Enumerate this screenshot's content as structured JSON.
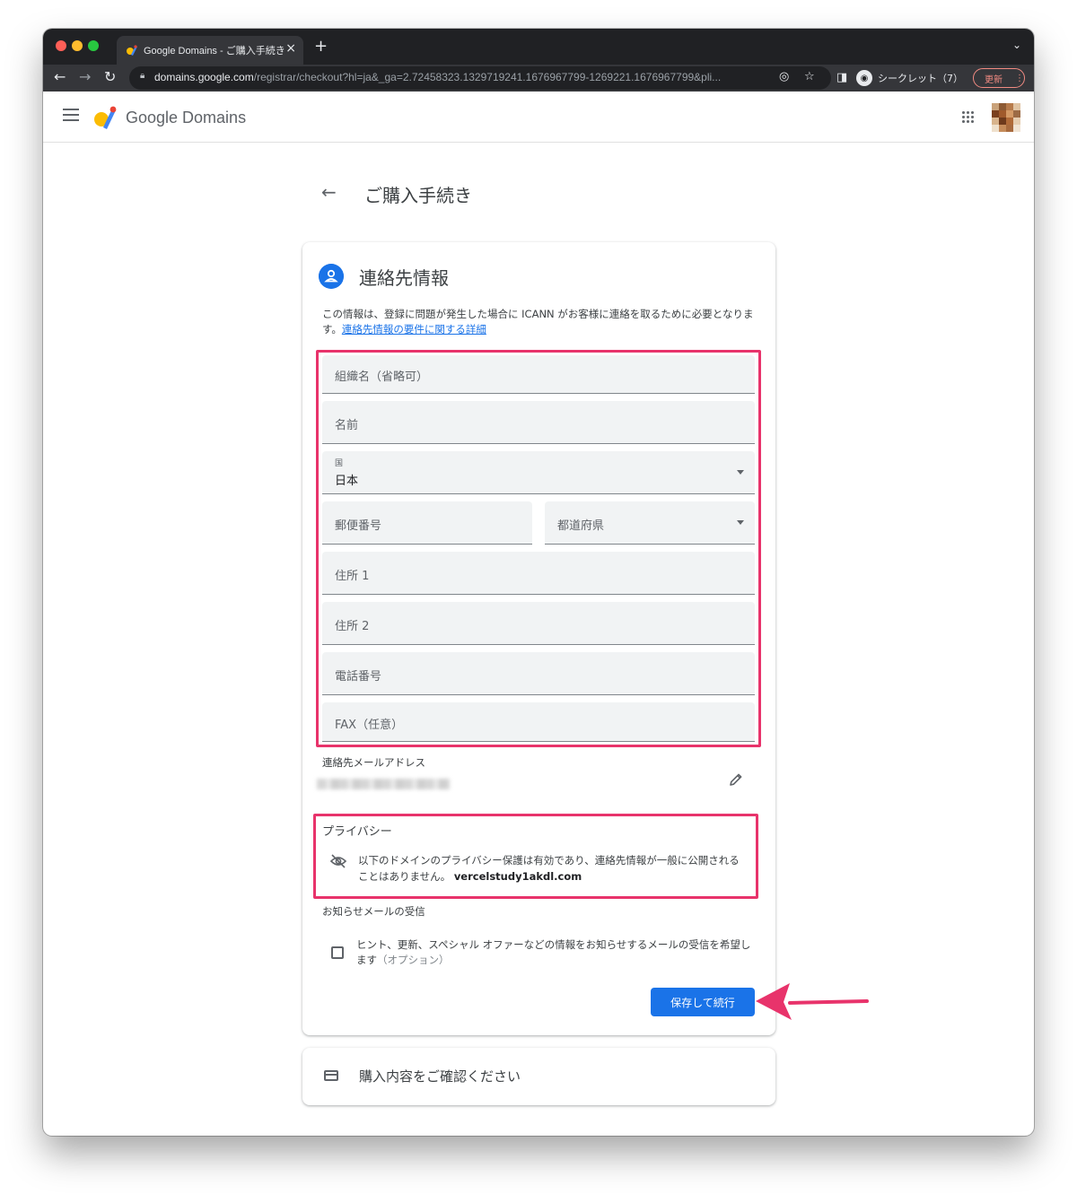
{
  "browser": {
    "tab_title": "Google Domains - ご購入手続き",
    "url_host": "domains.google.com",
    "url_path": "/registrar/checkout?hl=ja&_ga=2.72458323.1329719241.1676967799-1269221.1676967799&pli...",
    "incognito_label": "シークレット（7）",
    "update_label": "更新"
  },
  "app": {
    "brand": "Google Domains"
  },
  "page": {
    "title": "ご購入手続き"
  },
  "contact": {
    "section_title": "連絡先情報",
    "intro": "この情報は、登録に問題が発生した場合に ICANN がお客様に連絡を取るために必要となります。",
    "intro_link": "連絡先情報の要件に関する詳細",
    "fields": {
      "organization": "組織名（省略可）",
      "name": "名前",
      "country_label": "国",
      "country_value": "日本",
      "postal_code": "郵便番号",
      "prefecture": "都道府県",
      "address1": "住所 1",
      "address2": "住所 2",
      "phone": "電話番号",
      "fax": "FAX（任意）"
    },
    "email_label": "連絡先メールアドレス",
    "privacy_title": "プライバシー",
    "privacy_text": "以下のドメインのプライバシー保護は有効であり、連絡先情報が一般に公開されることはありません。",
    "privacy_domain": "vercelstudy1akdl.com",
    "newsletter_label": "お知らせメールの受信",
    "newsletter_text": "ヒント、更新、スペシャル オファーなどの情報をお知らせするメールの受信を希望します",
    "newsletter_optional": "（オプション）",
    "save_button": "保存して続行"
  },
  "review": {
    "title": "購入内容をご確認ください"
  },
  "colors": {
    "accent": "#1a73e8",
    "highlight": "#e8336b"
  }
}
